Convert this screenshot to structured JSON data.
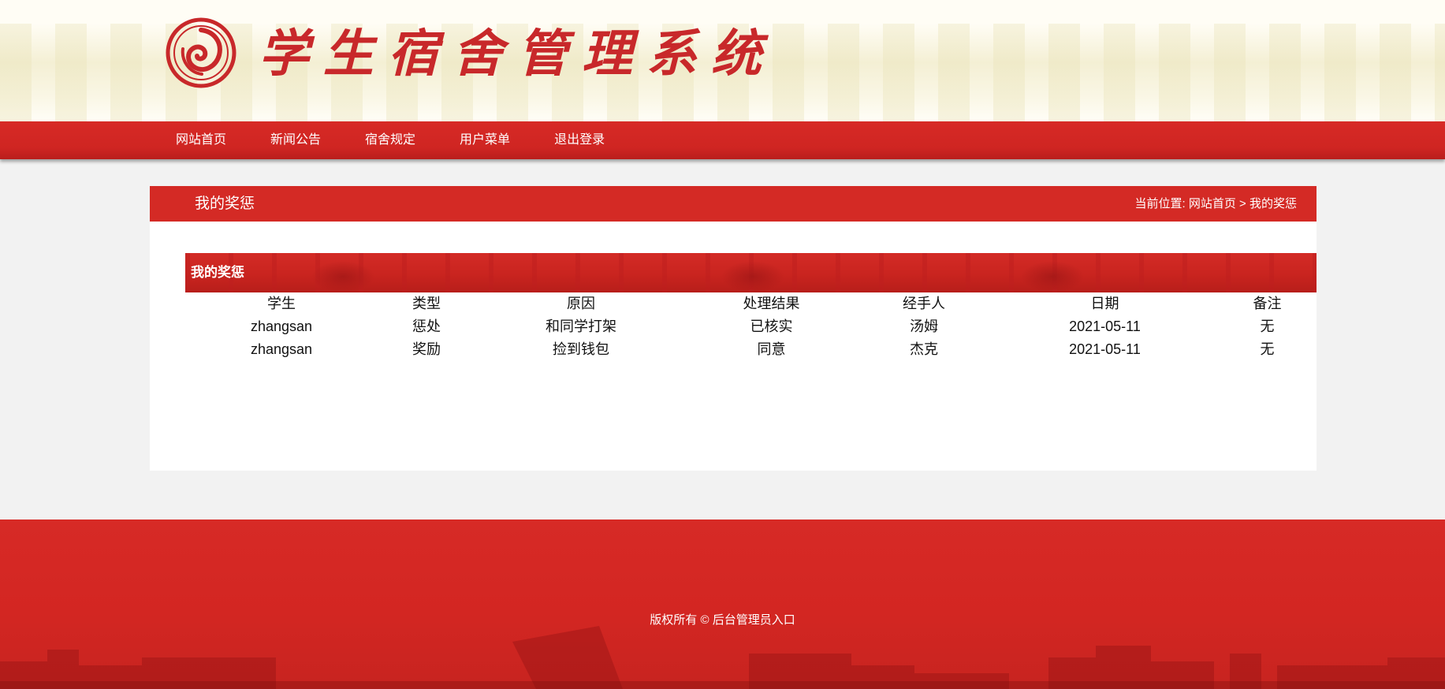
{
  "header": {
    "site_title": "学生宿舍管理系统"
  },
  "nav": {
    "items": [
      "网站首页",
      "新闻公告",
      "宿舍规定",
      "用户菜单",
      "退出登录"
    ]
  },
  "panel": {
    "title": "我的奖惩",
    "breadcrumb_prefix": "当前位置:",
    "breadcrumb_home": "网站首页",
    "breadcrumb_sep": ">",
    "breadcrumb_current": "我的奖惩"
  },
  "section": {
    "title": "我的奖惩"
  },
  "table": {
    "headers": [
      "学生",
      "类型",
      "原因",
      "处理结果",
      "经手人",
      "日期",
      "备注"
    ],
    "rows": [
      [
        "zhangsan",
        "惩处",
        "和同学打架",
        "已核实",
        "汤姆",
        "2021-05-11",
        "无"
      ],
      [
        "zhangsan",
        "奖励",
        "捡到钱包",
        "同意",
        "杰克",
        "2021-05-11",
        "无"
      ]
    ]
  },
  "footer": {
    "copyright": "版权所有 ©",
    "admin_link": "后台管理员入口"
  },
  "colors": {
    "brand_red": "#d42a25",
    "title_red": "#c8282a"
  },
  "icons": {
    "logo": "school-emblem-icon"
  }
}
